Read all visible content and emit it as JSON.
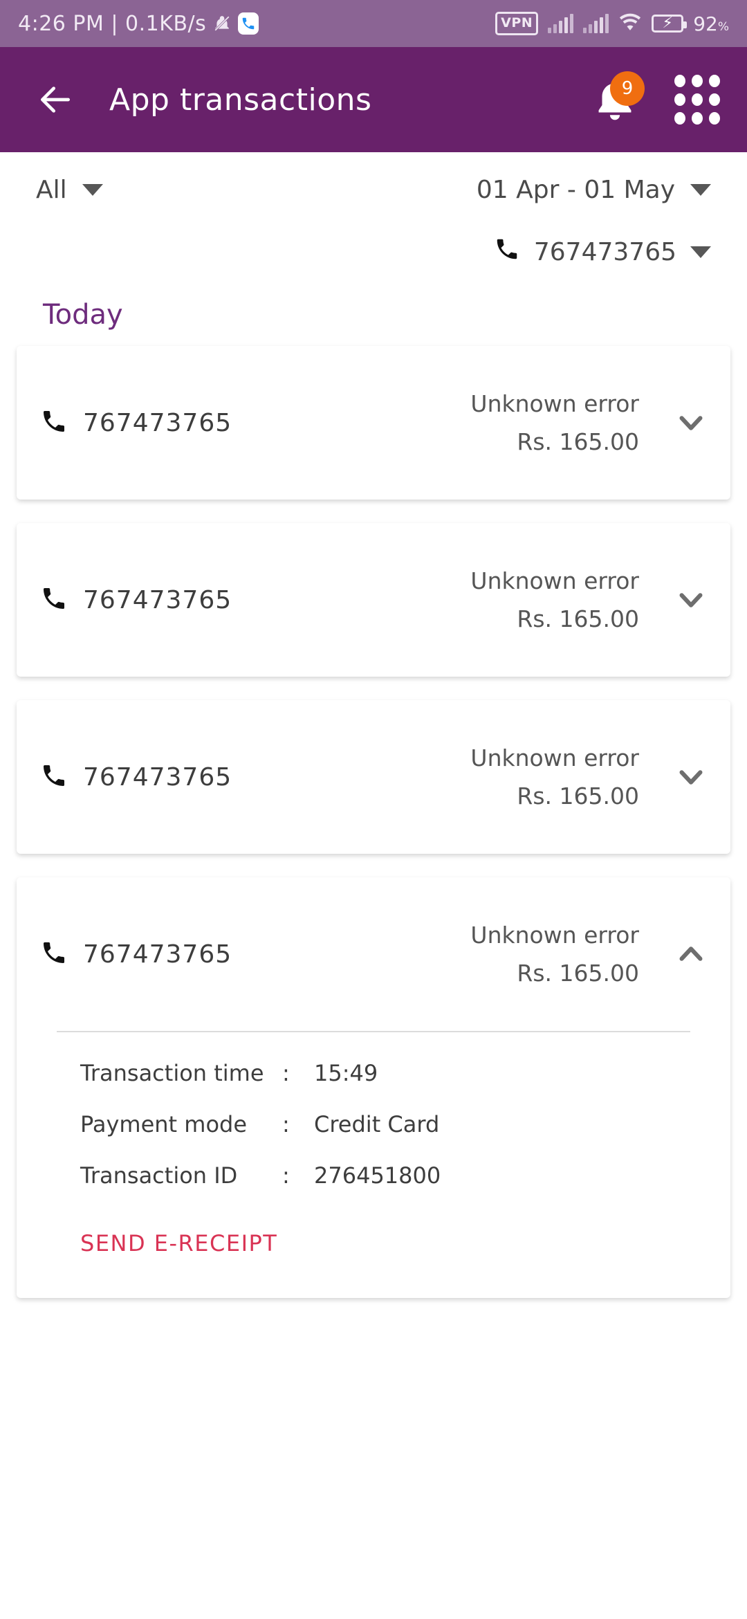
{
  "status_bar": {
    "clock": "4:26 PM | 0.1KB/s",
    "mute_icon": "bell-mute-icon",
    "call_icon": "phone-call-icon",
    "vpn_label": "VPN",
    "signal_icon_1": "signal-bars-icon",
    "signal_icon_2": "signal-bars-icon",
    "wifi_icon": "wifi-icon",
    "battery_icon": "battery-charging-icon",
    "battery_percent": "92",
    "battery_percent_symbol": "%",
    "bg_color": "#8B6494"
  },
  "app_bar": {
    "back_icon": "back-arrow-icon",
    "title": "App transactions",
    "bell_icon": "notification-bell-icon",
    "badge_count": "9",
    "badge_color": "#F06E10",
    "grid_icon": "apps-grid-icon",
    "bg_color": "#68216A"
  },
  "filters": {
    "type_filter": "All",
    "date_range": "01 Apr - 01 May",
    "phone_filter": "767473765",
    "phone_icon": "phone-icon",
    "caret_icon": "caret-down-icon"
  },
  "section": {
    "today_label": "Today",
    "today_color": "#6E2C7D"
  },
  "transactions": [
    {
      "phone": "767473765",
      "status": "Unknown error",
      "amount": "Rs. 165.00",
      "expanded": false,
      "chevron": "chevron-down-icon"
    },
    {
      "phone": "767473765",
      "status": "Unknown error",
      "amount": "Rs. 165.00",
      "expanded": false,
      "chevron": "chevron-down-icon"
    },
    {
      "phone": "767473765",
      "status": "Unknown error",
      "amount": "Rs. 165.00",
      "expanded": false,
      "chevron": "chevron-down-icon"
    },
    {
      "phone": "767473765",
      "status": "Unknown error",
      "amount": "Rs. 165.00",
      "expanded": true,
      "chevron": "chevron-up-icon",
      "details": {
        "rows": [
          {
            "label": "Transaction time",
            "colon": ":",
            "value": "15:49"
          },
          {
            "label": "Payment mode",
            "colon": ":",
            "value": "Credit Card"
          },
          {
            "label": "Transaction ID",
            "colon": ":",
            "value": "276451800"
          }
        ],
        "action_label": "SEND E-RECEIPT",
        "action_color": "#D93354"
      }
    }
  ]
}
